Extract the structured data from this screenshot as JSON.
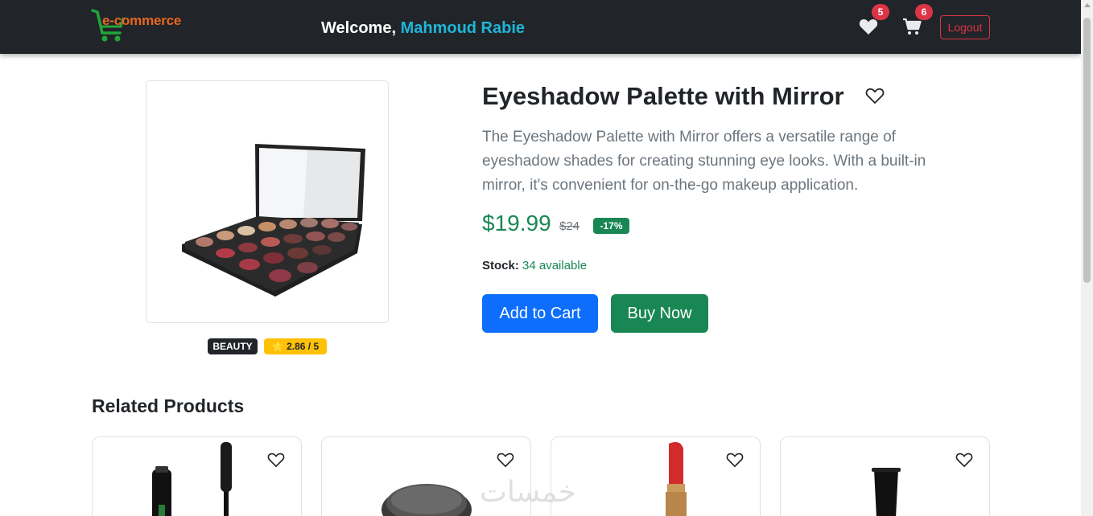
{
  "navbar": {
    "logo_text": "e-commerce",
    "welcome_prefix": "Welcome, ",
    "user_name": "Mahmoud Rabie",
    "wishlist_count": "5",
    "cart_count": "6",
    "logout_label": "Logout",
    "icons": [
      "heart-icon",
      "cart-icon"
    ]
  },
  "product": {
    "title": "Eyeshadow Palette with Mirror",
    "description": "The Eyeshadow Palette with Mirror offers a versatile range of eyeshadow shades for creating stunning eye looks. With a built-in mirror, it's convenient for on-the-go makeup application.",
    "price": "$19.99",
    "old_price": "$24",
    "discount": "-17%",
    "stock_label": "Stock:",
    "stock_value": "34 available",
    "category": "BEAUTY",
    "rating": "⭐ 2.86 / 5",
    "add_to_cart_label": "Add to Cart",
    "buy_now_label": "Buy Now"
  },
  "related": {
    "title": "Related Products",
    "cards": [
      {
        "name": "mascara"
      },
      {
        "name": "powder"
      },
      {
        "name": "lipstick"
      },
      {
        "name": "nail-polish"
      }
    ]
  },
  "watermark": "خمسات",
  "colors": {
    "navbar_bg": "#212529",
    "accent_user": "#1eb6d8",
    "primary": "#0d6efd",
    "success": "#198754",
    "danger": "#dc3545",
    "warning": "#ffc107"
  }
}
